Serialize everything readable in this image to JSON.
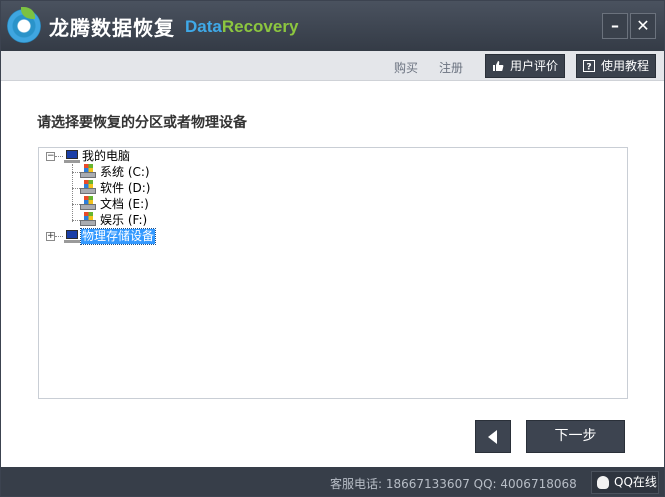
{
  "app": {
    "title": "龙腾数据恢复",
    "brand_part1": "Data",
    "brand_part2": "Recovery",
    "minimize_icon": "minimize-icon",
    "close_icon": "close-icon"
  },
  "topnav": {
    "buy_label": "购买",
    "register_label": "注册",
    "review_label": "用户评价",
    "tutorial_label": "使用教程"
  },
  "content": {
    "prompt": "请选择要恢复的分区或者物理设备",
    "tree": {
      "root_label": "我的电脑",
      "drives": [
        {
          "label": "系统 (C:)"
        },
        {
          "label": "软件 (D:)"
        },
        {
          "label": "文档 (E:)"
        },
        {
          "label": "娱乐 (F:)"
        }
      ],
      "physical_label": "物理存储设备",
      "selected": "物理存储设备"
    }
  },
  "buttons": {
    "next_label": "下一步"
  },
  "status": {
    "contact": "客服电话: 18667133607  QQ: 4006718068",
    "qq_label": "QQ在线"
  },
  "colors": {
    "titlebar": "#3b424d",
    "brand_blue": "#3fa9e8",
    "brand_green": "#8cc63f",
    "selection": "#3399ff"
  }
}
